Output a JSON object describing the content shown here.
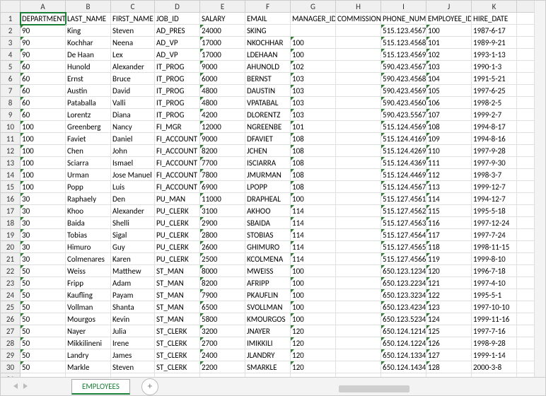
{
  "columns": [
    "A",
    "B",
    "C",
    "D",
    "E",
    "F",
    "G",
    "H",
    "I",
    "J",
    "K",
    ""
  ],
  "headers": [
    "DEPARTMENT_ID",
    "LAST_NAME",
    "FIRST_NAME",
    "JOB_ID",
    "SALARY",
    "EMAIL",
    "MANAGER_ID",
    "COMMISSION_PCT",
    "PHONE_NUMBER",
    "EMPLOYEE_ID",
    "HIRE_DATE",
    ""
  ],
  "rows": [
    {
      "n": 2,
      "dep": "90",
      "last": "King",
      "first": "Steven",
      "job": "AD_PRES",
      "sal": "24000",
      "email": "SKING",
      "mgr": "",
      "comm": "",
      "phone": "515.123.4567",
      "emp": "100",
      "hire": "1987-6-17"
    },
    {
      "n": 3,
      "dep": "90",
      "last": "Kochhar",
      "first": "Neena",
      "job": "AD_VP",
      "sal": "17000",
      "email": "NKOCHHAR",
      "mgr": "100",
      "comm": "",
      "phone": "515.123.4568",
      "emp": "101",
      "hire": "1989-9-21"
    },
    {
      "n": 4,
      "dep": "90",
      "last": "De Haan",
      "first": "Lex",
      "job": "AD_VP",
      "sal": "17000",
      "email": "LDEHAAN",
      "mgr": "100",
      "comm": "",
      "phone": "515.123.4569",
      "emp": "102",
      "hire": "1993-1-13"
    },
    {
      "n": 5,
      "dep": "60",
      "last": "Hunold",
      "first": "Alexander",
      "job": "IT_PROG",
      "sal": "9000",
      "email": "AHUNOLD",
      "mgr": "102",
      "comm": "",
      "phone": "590.423.4567",
      "emp": "103",
      "hire": "1990-1-3"
    },
    {
      "n": 6,
      "dep": "60",
      "last": "Ernst",
      "first": "Bruce",
      "job": "IT_PROG",
      "sal": "6000",
      "email": "BERNST",
      "mgr": "103",
      "comm": "",
      "phone": "590.423.4568",
      "emp": "104",
      "hire": "1991-5-21"
    },
    {
      "n": 7,
      "dep": "60",
      "last": "Austin",
      "first": "David",
      "job": "IT_PROG",
      "sal": "4800",
      "email": "DAUSTIN",
      "mgr": "103",
      "comm": "",
      "phone": "590.423.4569",
      "emp": "105",
      "hire": "1997-6-25"
    },
    {
      "n": 8,
      "dep": "60",
      "last": "Pataballa",
      "first": "Valli",
      "job": "IT_PROG",
      "sal": "4800",
      "email": "VPATABAL",
      "mgr": "103",
      "comm": "",
      "phone": "590.423.4560",
      "emp": "106",
      "hire": "1998-2-5"
    },
    {
      "n": 9,
      "dep": "60",
      "last": "Lorentz",
      "first": "Diana",
      "job": "IT_PROG",
      "sal": "4200",
      "email": "DLORENTZ",
      "mgr": "103",
      "comm": "",
      "phone": "590.423.5567",
      "emp": "107",
      "hire": "1999-2-7"
    },
    {
      "n": 10,
      "dep": "100",
      "last": "Greenberg",
      "first": "Nancy",
      "job": "FI_MGR",
      "sal": "12000",
      "email": "NGREENBE",
      "mgr": "101",
      "comm": "",
      "phone": "515.124.4569",
      "emp": "108",
      "hire": "1994-8-17"
    },
    {
      "n": 11,
      "dep": "100",
      "last": "Faviet",
      "first": "Daniel",
      "job": "FI_ACCOUNT",
      "sal": "9000",
      "email": "DFAVIET",
      "mgr": "108",
      "comm": "",
      "phone": "515.124.4169",
      "emp": "109",
      "hire": "1994-8-16"
    },
    {
      "n": 12,
      "dep": "100",
      "last": "Chen",
      "first": "John",
      "job": "FI_ACCOUNT",
      "sal": "8200",
      "email": "JCHEN",
      "mgr": "108",
      "comm": "",
      "phone": "515.124.4269",
      "emp": "110",
      "hire": "1997-9-28"
    },
    {
      "n": 13,
      "dep": "100",
      "last": "Sciarra",
      "first": "Ismael",
      "job": "FI_ACCOUNT",
      "sal": "7700",
      "email": "ISCIARRA",
      "mgr": "108",
      "comm": "",
      "phone": "515.124.4369",
      "emp": "111",
      "hire": "1997-9-30"
    },
    {
      "n": 14,
      "dep": "100",
      "last": "Urman",
      "first": "Jose Manuel",
      "job": "FI_ACCOUNT",
      "sal": "7800",
      "email": "JMURMAN",
      "mgr": "108",
      "comm": "",
      "phone": "515.124.4469",
      "emp": "112",
      "hire": "1998-3-7"
    },
    {
      "n": 15,
      "dep": "100",
      "last": "Popp",
      "first": "Luis",
      "job": "FI_ACCOUNT",
      "sal": "6900",
      "email": "LPOPP",
      "mgr": "108",
      "comm": "",
      "phone": "515.124.4567",
      "emp": "113",
      "hire": "1999-12-7"
    },
    {
      "n": 16,
      "dep": "30",
      "last": "Raphaely",
      "first": "Den",
      "job": "PU_MAN",
      "sal": "11000",
      "email": "DRAPHEAL",
      "mgr": "100",
      "comm": "",
      "phone": "515.127.4561",
      "emp": "114",
      "hire": "1994-12-7"
    },
    {
      "n": 17,
      "dep": "30",
      "last": "Khoo",
      "first": "Alexander",
      "job": "PU_CLERK",
      "sal": "3100",
      "email": "AKHOO",
      "mgr": "114",
      "comm": "",
      "phone": "515.127.4562",
      "emp": "115",
      "hire": "1995-5-18"
    },
    {
      "n": 18,
      "dep": "30",
      "last": "Baida",
      "first": "Shelli",
      "job": "PU_CLERK",
      "sal": "2900",
      "email": "SBAIDA",
      "mgr": "114",
      "comm": "",
      "phone": "515.127.4563",
      "emp": "116",
      "hire": "1997-12-24"
    },
    {
      "n": 19,
      "dep": "30",
      "last": "Tobias",
      "first": "Sigal",
      "job": "PU_CLERK",
      "sal": "2800",
      "email": "STOBIAS",
      "mgr": "114",
      "comm": "",
      "phone": "515.127.4564",
      "emp": "117",
      "hire": "1997-7-24"
    },
    {
      "n": 20,
      "dep": "30",
      "last": "Himuro",
      "first": "Guy",
      "job": "PU_CLERK",
      "sal": "2600",
      "email": "GHIMURO",
      "mgr": "114",
      "comm": "",
      "phone": "515.127.4565",
      "emp": "118",
      "hire": "1998-11-15"
    },
    {
      "n": 21,
      "dep": "30",
      "last": "Colmenares",
      "first": "Karen",
      "job": "PU_CLERK",
      "sal": "2500",
      "email": "KCOLMENA",
      "mgr": "114",
      "comm": "",
      "phone": "515.127.4566",
      "emp": "119",
      "hire": "1999-8-10"
    },
    {
      "n": 22,
      "dep": "50",
      "last": "Weiss",
      "first": "Matthew",
      "job": "ST_MAN",
      "sal": "8000",
      "email": "MWEISS",
      "mgr": "100",
      "comm": "",
      "phone": "650.123.1234",
      "emp": "120",
      "hire": "1996-7-18"
    },
    {
      "n": 23,
      "dep": "50",
      "last": "Fripp",
      "first": "Adam",
      "job": "ST_MAN",
      "sal": "8200",
      "email": "AFRIPP",
      "mgr": "100",
      "comm": "",
      "phone": "650.123.2234",
      "emp": "121",
      "hire": "1997-4-10"
    },
    {
      "n": 24,
      "dep": "50",
      "last": "Kaufling",
      "first": "Payam",
      "job": "ST_MAN",
      "sal": "7900",
      "email": "PKAUFLIN",
      "mgr": "100",
      "comm": "",
      "phone": "650.123.3234",
      "emp": "122",
      "hire": "1995-5-1"
    },
    {
      "n": 25,
      "dep": "50",
      "last": "Vollman",
      "first": "Shanta",
      "job": "ST_MAN",
      "sal": "6500",
      "email": "SVOLLMAN",
      "mgr": "100",
      "comm": "",
      "phone": "650.123.4234",
      "emp": "123",
      "hire": "1997-10-10"
    },
    {
      "n": 26,
      "dep": "50",
      "last": "Mourgos",
      "first": "Kevin",
      "job": "ST_MAN",
      "sal": "5800",
      "email": "KMOURGOS",
      "mgr": "100",
      "comm": "",
      "phone": "650.123.5234",
      "emp": "124",
      "hire": "1999-11-16"
    },
    {
      "n": 27,
      "dep": "50",
      "last": "Nayer",
      "first": "Julia",
      "job": "ST_CLERK",
      "sal": "3200",
      "email": "JNAYER",
      "mgr": "120",
      "comm": "",
      "phone": "650.124.1214",
      "emp": "125",
      "hire": "1997-7-16"
    },
    {
      "n": 28,
      "dep": "50",
      "last": "Mikkilineni",
      "first": "Irene",
      "job": "ST_CLERK",
      "sal": "2700",
      "email": "IMIKKILI",
      "mgr": "120",
      "comm": "",
      "phone": "650.124.1224",
      "emp": "126",
      "hire": "1998-9-28"
    },
    {
      "n": 29,
      "dep": "50",
      "last": "Landry",
      "first": "James",
      "job": "ST_CLERK",
      "sal": "2400",
      "email": "JLANDRY",
      "mgr": "120",
      "comm": "",
      "phone": "650.124.1334",
      "emp": "127",
      "hire": "1999-1-14"
    },
    {
      "n": 30,
      "dep": "50",
      "last": "Markle",
      "first": "Steven",
      "job": "ST_CLERK",
      "sal": "2200",
      "email": "SMARKLE",
      "mgr": "120",
      "comm": "",
      "phone": "650.124.1434",
      "emp": "128",
      "hire": "2000-3-8"
    }
  ],
  "sheet_tab": "EMPLOYEES",
  "selected_cell": "A1",
  "triangle_cols": {
    "dep": true,
    "sal": true,
    "mgr": true,
    "phone": true,
    "emp": true
  }
}
